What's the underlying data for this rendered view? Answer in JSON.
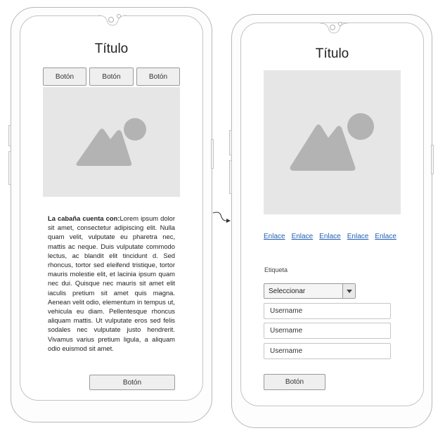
{
  "left_screen": {
    "title": "Título",
    "tab_buttons": [
      "Botón",
      "Botón",
      "Botón"
    ],
    "paragraph_bold": "La cabaña cuenta con:",
    "paragraph": "Lorem ipsum dolor sit amet, consectetur adipiscing elit. Nulla quam velit, vulputate eu pharetra nec, mattis ac neque. Duis vulputate commodo lectus, ac blandit elit tincidunt d. Sed rhoncus, tortor sed eleifend tristique, tortor mauris molestie elit, et lacinia ipsum quam nec dui. Quisque nec mauris sit amet elit iaculis pretium sit amet quis magna. Aenean velit odio, elementum in tempus ut, vehicula eu diam. Pellentesque rhoncus aliquam mattis. Ut vulputate eros sed felis sodales nec vulputate justo hendrerit. Vivamus varius pretium ligula, a aliquam odio euismod sit amet.",
    "bottom_button": "Botón"
  },
  "right_screen": {
    "title": "Título",
    "links": [
      "Enlace",
      "Enlace",
      "Enlace",
      "Enlace",
      "Enlace"
    ],
    "field_label": "Etiqueta",
    "select_value": "Seleccionar",
    "inputs": [
      "Username",
      "Username",
      "Username"
    ],
    "button": "Botón"
  },
  "colors": {
    "image_placeholder_bg": "#e6e6e6",
    "image_placeholder_shape": "#b3b3b3",
    "link": "#1f5fb5",
    "connector": "#333333"
  },
  "icons": [
    "image-placeholder-icon",
    "mountain-icon",
    "sun-icon",
    "dropdown-arrow-icon",
    "connector-arrow-icon"
  ]
}
